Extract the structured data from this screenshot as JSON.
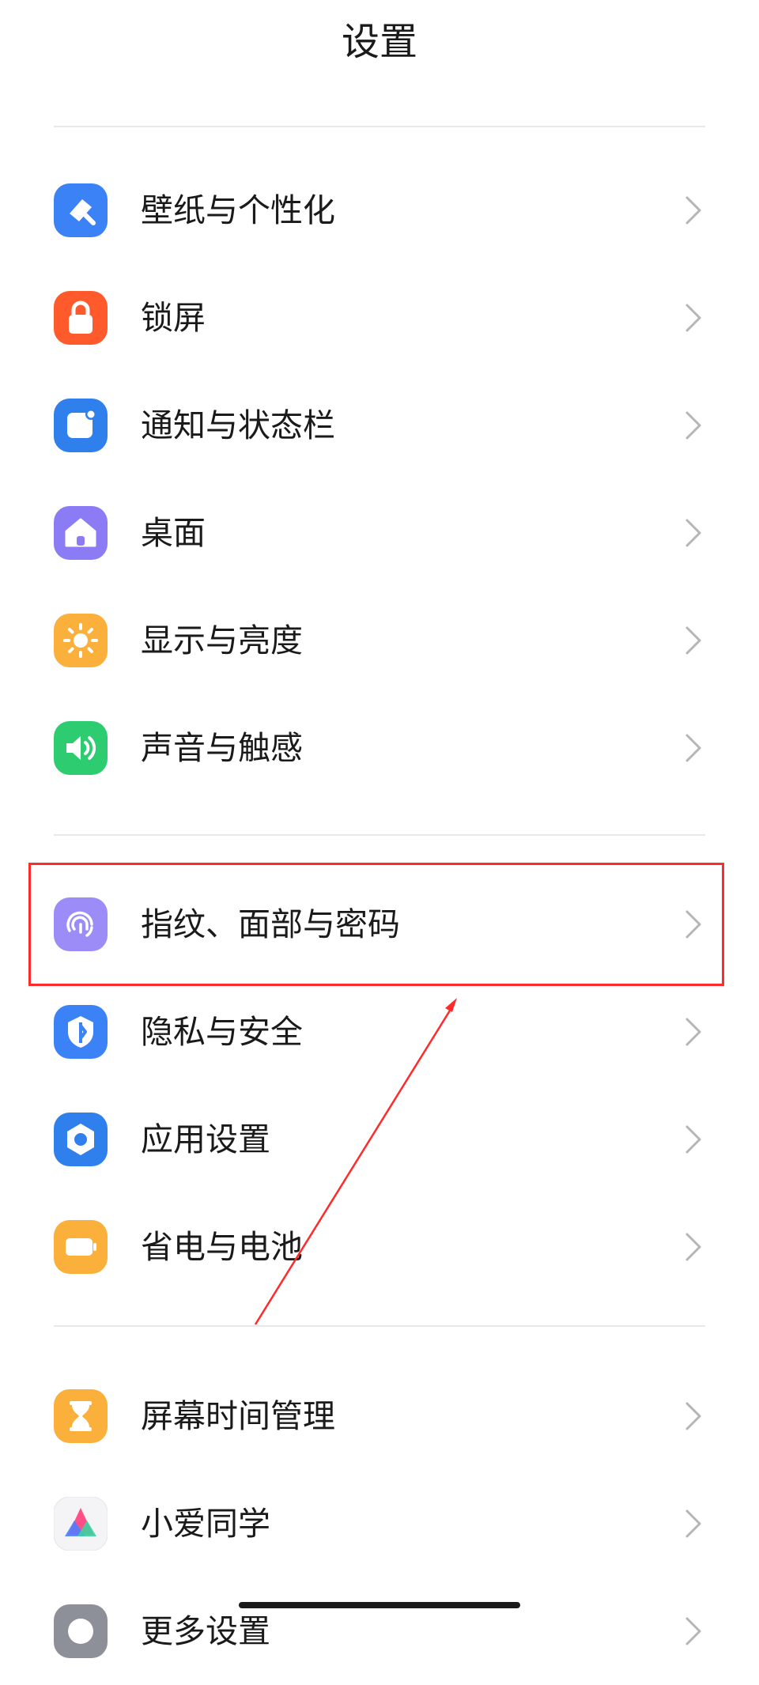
{
  "header": {
    "title": "设置"
  },
  "groups": [
    {
      "items": [
        {
          "label": "壁纸与个性化",
          "icon": "brush-icon",
          "color": "#3b82f6"
        },
        {
          "label": "锁屏",
          "icon": "lock-icon",
          "color": "#ff5a2c"
        },
        {
          "label": "通知与状态栏",
          "icon": "notification-icon",
          "color": "#2f80ed"
        },
        {
          "label": "桌面",
          "icon": "home-icon",
          "color": "#8b7cf6"
        },
        {
          "label": "显示与亮度",
          "icon": "sun-icon",
          "color": "#fbb03b"
        },
        {
          "label": "声音与触感",
          "icon": "speaker-icon",
          "color": "#2ecc71"
        }
      ]
    },
    {
      "items": [
        {
          "label": "指纹、面部与密码",
          "icon": "fingerprint-icon",
          "color": "#9b8cf7"
        },
        {
          "label": "隐私与安全",
          "icon": "shield-icon",
          "color": "#3b82f6"
        },
        {
          "label": "应用设置",
          "icon": "hexagon-gear-icon",
          "color": "#2f80ed"
        },
        {
          "label": "省电与电池",
          "icon": "battery-icon",
          "color": "#fbb03b"
        }
      ]
    },
    {
      "items": [
        {
          "label": "屏幕时间管理",
          "icon": "hourglass-icon",
          "color": "#fbb03b"
        },
        {
          "label": "小爱同学",
          "icon": "xiaoai-icon",
          "color": "#f2f2f2"
        },
        {
          "label": "更多设置",
          "icon": "more-settings-icon",
          "color": "#8e9099"
        }
      ]
    }
  ],
  "annotation": {
    "color": "#ff2b2b",
    "highlighted_item": "指纹、面部与密码"
  }
}
